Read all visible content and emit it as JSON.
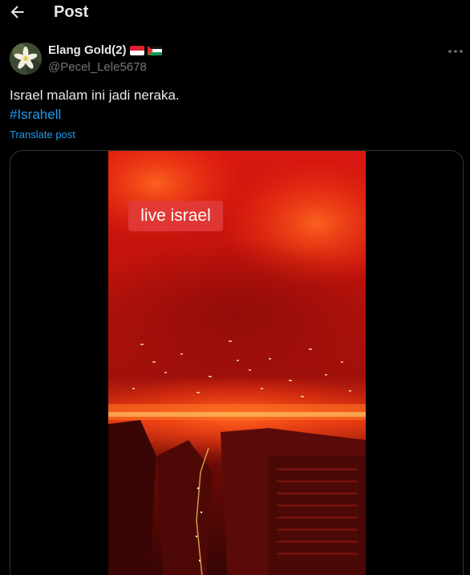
{
  "header": {
    "title": "Post",
    "back_icon": "arrow-left-icon"
  },
  "author": {
    "display_name": "Elang Gold(2)",
    "handle": "@Pecel_Lele5678",
    "flags": [
      "indonesia-flag",
      "palestine-flag"
    ]
  },
  "tweet": {
    "text": "Israel malam ini jadi neraka.",
    "hashtag": "#Israhell",
    "translate_label": "Translate post"
  },
  "media": {
    "overlay_label": "live israel"
  },
  "colors": {
    "background": "#000000",
    "text": "#e7e9ea",
    "secondary": "#71767b",
    "link": "#1d9bf0",
    "border": "#2f3336"
  }
}
